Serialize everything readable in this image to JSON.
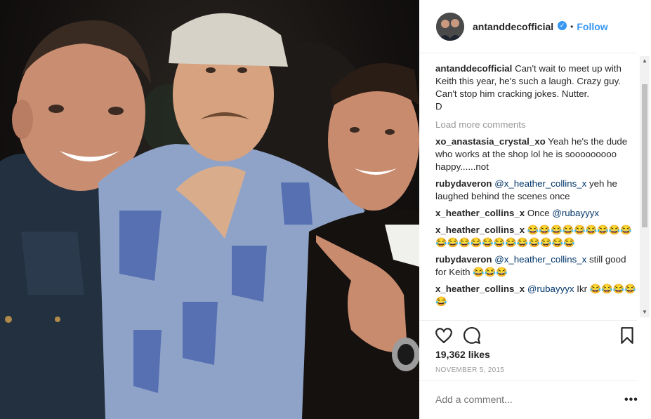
{
  "post": {
    "username": "antanddecofficial",
    "verified_icon": "check",
    "follow_label": "Follow",
    "separator": "•"
  },
  "caption": {
    "username": "antanddecofficial",
    "text": "Can't wait to meet up with Keith this year, he's such a laugh. Crazy guy. Can't stop him cracking jokes. Nutter.",
    "signoff": "D"
  },
  "load_more": "Load more comments",
  "comments": [
    {
      "username": "xo_anastasia_crystal_xo",
      "mention": "",
      "text": "Yeah he's the dude who works at the shop lol he is sooooooooo happy......not"
    },
    {
      "username": "rubydaveron",
      "mention": "@x_heather_collins_x",
      "text": "yeh he laughed behind the scenes once"
    },
    {
      "username": "x_heather_collins_x",
      "mention": "",
      "text": "Once",
      "mention_after": "@rubayyyx"
    },
    {
      "username": "x_heather_collins_x",
      "mention": "",
      "text": "😂😂😂😂😂😂😂😂😂😂😂😂😂😂😂😂😂😂😂😂😂"
    },
    {
      "username": "rubydaveron",
      "mention": "@x_heather_collins_x",
      "text": "still good for Keith 😂😂😂"
    },
    {
      "username": "x_heather_collins_x",
      "mention": "@rubayyyx",
      "text": "Ikr 😂😂😂😂😂"
    }
  ],
  "likes": "19,362 likes",
  "date": "NOVEMBER 5, 2015",
  "add_comment_placeholder": "Add a comment...",
  "more_label": "•••",
  "icons": {
    "like": "heart-icon",
    "comment": "speech-bubble-icon",
    "save": "bookmark-icon",
    "more": "ellipsis-icon"
  },
  "colors": {
    "accent": "#3897f0",
    "mention": "#003569",
    "muted": "#999999",
    "text": "#262626"
  }
}
